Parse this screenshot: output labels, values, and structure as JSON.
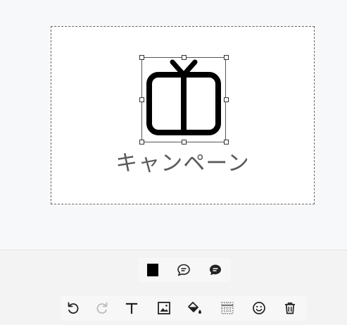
{
  "canvas": {
    "caption_text": "キャンペーン",
    "graphic": {
      "icon": "gift-icon",
      "color": "#000000"
    }
  },
  "style_bar": {
    "color_swatch": "#000000",
    "items": [
      "color-swatch",
      "speech-bubble-outline-icon",
      "speech-bubble-filled-icon"
    ]
  },
  "toolbar": {
    "items": [
      "undo-icon",
      "redo-icon",
      "text-icon",
      "image-icon",
      "fill-icon",
      "background-pattern-icon",
      "emoji-icon",
      "delete-icon"
    ],
    "redo_enabled": false
  },
  "colors": {
    "canvas_bg": "#f7f8fa",
    "panel_bg": "#f3f3f3",
    "icon": "#222222",
    "icon_disabled": "#bbbbbb"
  }
}
